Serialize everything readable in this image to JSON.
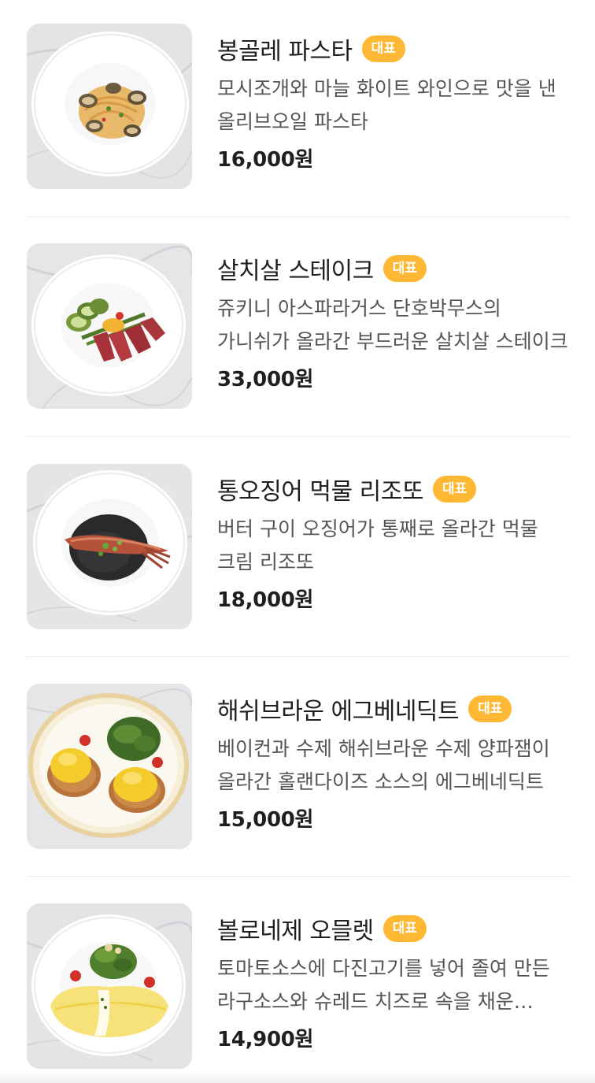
{
  "menu": {
    "items": [
      {
        "name": "봉골레 파스타",
        "badge": "대표",
        "description": "모시조개와 마늘 화이트 와인으로 맛을 낸 올리브오일 파스타",
        "price": "16,000원",
        "image": "vongole-pasta-dish"
      },
      {
        "name": "살치살 스테이크",
        "badge": "대표",
        "description": "쥬키니 아스파라거스 단호박무스의 가니쉬가 올라간 부드러운 살치살 스테이크",
        "price": "33,000원",
        "image": "chuck-flap-steak-dish"
      },
      {
        "name": "통오징어 먹물 리조또",
        "badge": "대표",
        "description": "버터 구이 오징어가 통째로 올라간 먹물 크림 리조또",
        "price": "18,000원",
        "image": "squid-ink-risotto-dish"
      },
      {
        "name": "해쉬브라운 에그베네딕트",
        "badge": "대표",
        "description": "베이컨과 수제 해쉬브라운 수제 양파잼이 올라간 홀랜다이즈 소스의 에그베네딕트",
        "price": "15,000원",
        "image": "hashbrown-eggs-benedict-dish"
      },
      {
        "name": "볼로네제 오믈렛",
        "badge": "대표",
        "description": "토마토소스에 다진고기를 넣어 졸여 만든 라구소스와 슈레드 치즈로 속을 채운 오믈렛",
        "price": "14,900원",
        "image": "bolognese-omelette-dish"
      }
    ]
  },
  "colors": {
    "badge": "#ffb833",
    "price": "#1f1f1f",
    "description": "#555555",
    "divider": "#ececec"
  }
}
